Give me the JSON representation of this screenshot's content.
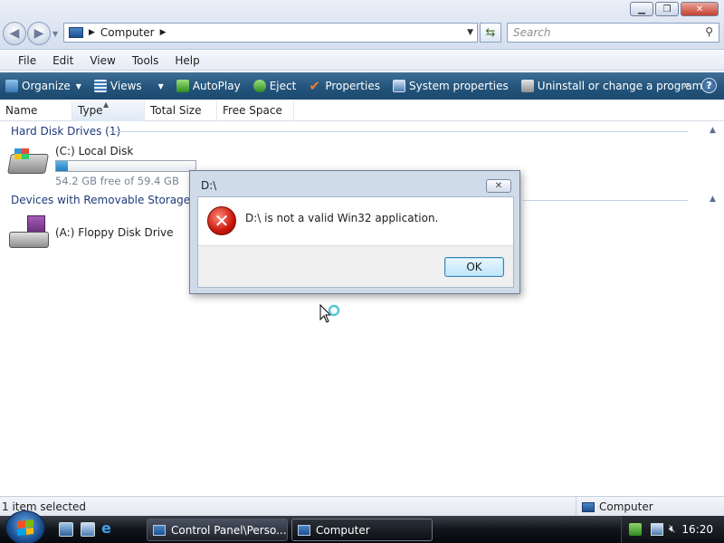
{
  "window": {
    "minimize": "▁",
    "maximize": "❐",
    "close": "✕"
  },
  "nav": {
    "back_icon": "◀",
    "forward_icon": "▶",
    "address_path": "Computer",
    "search_placeholder": "Search"
  },
  "menu": {
    "items": [
      "File",
      "Edit",
      "View",
      "Tools",
      "Help"
    ]
  },
  "commands": {
    "organize": "Organize",
    "views": "Views",
    "autoplay": "AutoPlay",
    "eject": "Eject",
    "properties": "Properties",
    "system_properties": "System properties",
    "uninstall": "Uninstall or change a program",
    "more": "»",
    "help": "?"
  },
  "columns": [
    "Name",
    "Type",
    "Total Size",
    "Free Space"
  ],
  "groups": {
    "hard_disks": {
      "header": "Hard Disk Drives (1)",
      "drives": [
        {
          "name": "(C:) Local Disk",
          "free_text": "54.2 GB free of 59.4 GB",
          "used_fraction": 0.087
        }
      ]
    },
    "removable": {
      "header": "Devices with Removable Storage (2)",
      "drives": [
        {
          "name": "(A:) Floppy Disk Drive"
        }
      ]
    }
  },
  "dialog": {
    "title": "D:\\",
    "message": "D:\\ is not a valid Win32 application.",
    "ok_label": "OK",
    "close_label": "✕",
    "error_glyph": "✕"
  },
  "status": {
    "left": "1 item selected",
    "right": "Computer"
  },
  "taskbar": {
    "tasks": [
      {
        "label": "Control Panel\\Perso..."
      },
      {
        "label": "Computer"
      }
    ],
    "clock": "16:20"
  },
  "colors": {
    "command_bar": "#24547b",
    "group_header": "#1e3a7b",
    "capacity_fill": "#1f7fbf",
    "error_red": "#c8160a"
  }
}
